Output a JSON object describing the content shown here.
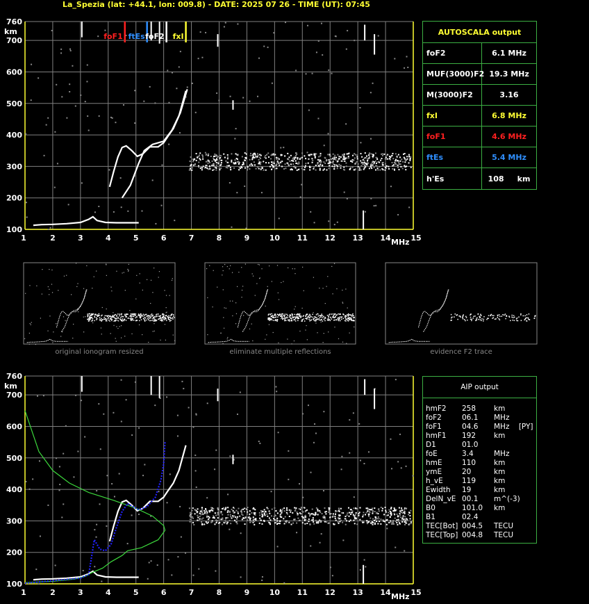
{
  "title": "La_Spezia (lat: +44.1, lon: 009.8) - DATE: 2025 07 26 - TIME (UT): 07:45",
  "chart_data": [
    {
      "type": "scatter",
      "title": "",
      "ylabel": "km",
      "xlabel": "MHz",
      "xlim": [
        1,
        15
      ],
      "ylim": [
        100,
        760
      ],
      "x_ticks": [
        1,
        2,
        3,
        4,
        5,
        6,
        7,
        8,
        9,
        10,
        11,
        12,
        13,
        14,
        15
      ],
      "y_ticks": [
        100,
        200,
        300,
        400,
        500,
        600,
        700,
        760
      ],
      "markers": [
        {
          "label": "foF1",
          "x": 4.6,
          "color": "#ff2020"
        },
        {
          "label": "ftEs",
          "x": 5.4,
          "color": "#2f8fff"
        },
        {
          "label": "foF2",
          "x": 6.1,
          "color": "#ffffff"
        },
        {
          "label": "fxI",
          "x": 6.8,
          "color": "#ffff33"
        }
      ],
      "series": [
        {
          "color": "#ffffff",
          "points": [
            [
              1.3,
              113
            ],
            [
              1.6,
              115
            ],
            [
              2,
              116
            ],
            [
              2.5,
              118
            ],
            [
              3,
              122
            ],
            [
              3.3,
              132
            ],
            [
              3.45,
              140
            ],
            [
              3.6,
              128
            ],
            [
              3.9,
              122
            ],
            [
              4.3,
              121
            ],
            [
              4.8,
              121
            ],
            [
              5.1,
              121
            ]
          ]
        },
        {
          "color": "#ffffff",
          "points": [
            [
              4.05,
              235
            ],
            [
              4.2,
              285
            ],
            [
              4.35,
              330
            ],
            [
              4.5,
              360
            ],
            [
              4.65,
              365
            ],
            [
              4.85,
              350
            ],
            [
              5.05,
              332
            ],
            [
              5.25,
              340
            ],
            [
              5.5,
              362
            ],
            [
              5.8,
              362
            ],
            [
              6.0,
              375
            ],
            [
              6.15,
              395
            ],
            [
              6.35,
              420
            ],
            [
              6.55,
              460
            ],
            [
              6.8,
              540
            ]
          ]
        },
        {
          "color": "#ffffff",
          "points": [
            [
              4.5,
              200
            ],
            [
              4.8,
              240
            ],
            [
              5.1,
              310
            ],
            [
              5.3,
              350
            ],
            [
              5.6,
              370
            ],
            [
              6.0,
              380
            ],
            [
              6.3,
              415
            ],
            [
              6.6,
              470
            ],
            [
              6.85,
              545
            ]
          ]
        }
      ]
    },
    {
      "type": "line",
      "title": "",
      "ylabel": "km",
      "xlabel": "MHz",
      "xlim": [
        1,
        15
      ],
      "ylim": [
        100,
        760
      ],
      "x_ticks": [
        1,
        2,
        3,
        4,
        5,
        6,
        7,
        8,
        9,
        10,
        11,
        12,
        13,
        14,
        15
      ],
      "y_ticks": [
        100,
        200,
        300,
        400,
        500,
        600,
        700,
        760
      ],
      "series": [
        {
          "color": "#ffffff",
          "points": [
            [
              1.3,
              113
            ],
            [
              1.6,
              115
            ],
            [
              2,
              116
            ],
            [
              2.5,
              118
            ],
            [
              3,
              122
            ],
            [
              3.3,
              132
            ],
            [
              3.45,
              140
            ],
            [
              3.6,
              128
            ],
            [
              3.9,
              122
            ],
            [
              4.3,
              121
            ],
            [
              4.8,
              121
            ],
            [
              5.1,
              121
            ]
          ]
        },
        {
          "color": "#ffffff",
          "points": [
            [
              4.05,
              235
            ],
            [
              4.2,
              285
            ],
            [
              4.35,
              330
            ],
            [
              4.5,
              360
            ],
            [
              4.65,
              365
            ],
            [
              4.85,
              350
            ],
            [
              5.05,
              332
            ],
            [
              5.25,
              340
            ],
            [
              5.5,
              362
            ],
            [
              5.8,
              362
            ],
            [
              6.0,
              375
            ],
            [
              6.15,
              395
            ],
            [
              6.35,
              420
            ],
            [
              6.55,
              460
            ],
            [
              6.8,
              540
            ]
          ]
        },
        {
          "color": "#3cd83c",
          "points": [
            [
              1.0,
              650
            ],
            [
              1.5,
              520
            ],
            [
              2.0,
              460
            ],
            [
              2.6,
              420
            ],
            [
              3.3,
              390
            ],
            [
              4.2,
              365
            ],
            [
              5.0,
              340
            ],
            [
              5.6,
              315
            ],
            [
              6.0,
              285
            ],
            [
              6.05,
              270
            ],
            [
              5.8,
              240
            ],
            [
              5.2,
              215
            ],
            [
              4.7,
              205
            ],
            [
              4.5,
              190
            ],
            [
              4.1,
              170
            ],
            [
              3.8,
              150
            ],
            [
              3.4,
              135
            ],
            [
              3.2,
              125
            ],
            [
              2.8,
              115
            ],
            [
              2.0,
              108
            ],
            [
              1.0,
              104
            ]
          ]
        },
        {
          "color": "#2222ff",
          "points": [
            [
              1.0,
              102
            ],
            [
              2.0,
              110
            ],
            [
              3.0,
              118
            ],
            [
              3.3,
              130
            ],
            [
              3.5,
              240
            ],
            [
              3.7,
              210
            ],
            [
              3.9,
              205
            ],
            [
              4.1,
              225
            ],
            [
              4.3,
              280
            ],
            [
              4.5,
              330
            ],
            [
              4.7,
              355
            ],
            [
              4.9,
              345
            ],
            [
              5.1,
              335
            ],
            [
              5.4,
              345
            ],
            [
              5.7,
              375
            ],
            [
              5.9,
              430
            ],
            [
              6.0,
              480
            ],
            [
              6.05,
              550
            ]
          ]
        }
      ]
    }
  ],
  "autoscala": {
    "header": "AUTOSCALA output",
    "rows": [
      {
        "k": "foF2",
        "v": "6.1 MHz",
        "kc": "#ffffff",
        "vc": "#ffffff"
      },
      {
        "k": "MUF(3000)F2",
        "v": "19.3 MHz",
        "kc": "#ffffff",
        "vc": "#ffffff"
      },
      {
        "k": "M(3000)F2",
        "v": "3.16",
        "kc": "#ffffff",
        "vc": "#ffffff"
      },
      {
        "k": "fxI",
        "v": "6.8 MHz",
        "kc": "#ffff33",
        "vc": "#ffff33"
      },
      {
        "k": "foF1",
        "v": "4.6 MHz",
        "kc": "#ff2020",
        "vc": "#ff2020"
      },
      {
        "k": "ftEs",
        "v": "5.4 MHz",
        "kc": "#2f8fff",
        "vc": "#2f8fff"
      },
      {
        "k": "h'Es",
        "v": "108     km",
        "kc": "#ffffff",
        "vc": "#ffffff"
      }
    ]
  },
  "thumbnails": [
    {
      "caption": "original ionogram resized"
    },
    {
      "caption": "eliminate multiple reflections"
    },
    {
      "caption": "evidence F2 trace"
    }
  ],
  "aip": {
    "header": "AIP output",
    "rows": [
      [
        "hmF2",
        "258",
        "km"
      ],
      [
        "foF2",
        "06.1",
        "MHz"
      ],
      [
        "foF1",
        "04.6",
        "MHz    [PY]"
      ],
      [
        "hmF1",
        "192",
        "km"
      ],
      [
        "D1",
        "01.0",
        ""
      ],
      [
        "foE",
        "3.4",
        "MHz"
      ],
      [
        "hmE",
        "110",
        "km"
      ],
      [
        "ymE",
        "20",
        "km"
      ],
      [
        "h_vE",
        "119",
        "km"
      ],
      [
        "Ewidth",
        "19",
        "km"
      ],
      [
        "DelN_vE",
        "00.1",
        "m^(-3)"
      ],
      [
        "B0",
        "101.0",
        "km"
      ],
      [
        "B1",
        "02.4",
        ""
      ],
      [
        "TEC[Bot]",
        "004.5",
        "TECU"
      ],
      [
        "TEC[Top]",
        "004.8",
        "TECU"
      ]
    ]
  }
}
